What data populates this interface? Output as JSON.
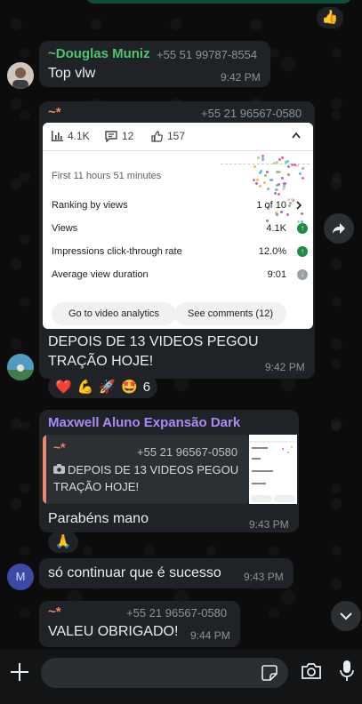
{
  "top_reaction": "👍",
  "msg1": {
    "sender": "~Douglas Muniz",
    "phone": "+55 51 99787-8554",
    "text": "Top vlw",
    "time": "9:42 PM",
    "sender_color": "#4fc36d"
  },
  "msg2": {
    "sender": "~*",
    "phone": "+55 21 96567-0580",
    "sender_color": "#e9866b",
    "analytics": {
      "views_stat": "4.1K",
      "comments_stat": "12",
      "likes_stat": "157",
      "period": "First 11 hours 51 minutes",
      "ranking_label": "Ranking by views",
      "ranking_value": "1 of 10",
      "rows": [
        {
          "label": "Views",
          "value": "4.1K"
        },
        {
          "label": "Impressions click-through rate",
          "value": "12.0%"
        },
        {
          "label": "Average view duration",
          "value": "9:01"
        }
      ],
      "btn_analytics": "Go to video analytics",
      "btn_comments": "See comments (12)"
    },
    "text": "DEPOIS DE 13 VIDEOS PEGOU TRAÇÃO HOJE!",
    "time": "9:42 PM",
    "reactions": [
      "❤️",
      "💪",
      "🚀",
      "🤩"
    ],
    "reaction_count": "6"
  },
  "msg3": {
    "sender": "Maxwell Aluno Expansão Dark",
    "sender_color": "#a98bf5",
    "quote_sender": "~*",
    "quote_phone": "+55 21 96567-0580",
    "quote_text": "DEPOIS DE 13 VIDEOS PEGOU TRAÇÃO HOJE!",
    "text": "Parabéns mano",
    "time": "9:43 PM",
    "reaction": "🙏"
  },
  "msg4": {
    "avatar_letter": "M",
    "text": "só continuar que é sucesso",
    "time": "9:43 PM"
  },
  "msg5": {
    "sender": "~*",
    "phone": "+55 21 96567-0580",
    "text": "VALEU OBRIGADO!",
    "time": "9:44 PM"
  },
  "composer": {
    "placeholder": ""
  },
  "accent": "#4fc36d"
}
